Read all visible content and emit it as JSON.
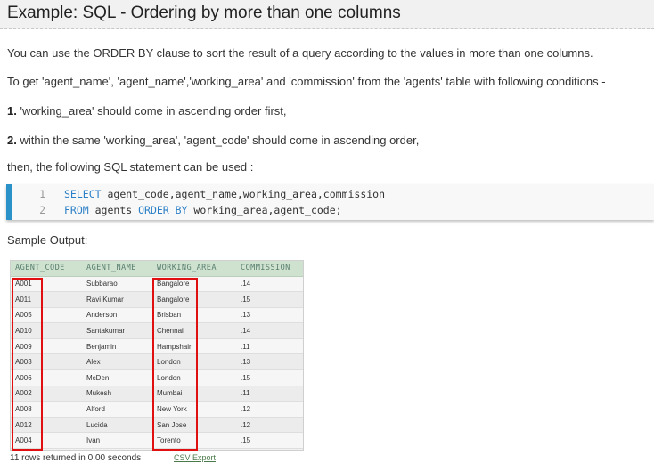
{
  "header": {
    "title": "Example: SQL - Ordering by more than one columns"
  },
  "paragraphs": {
    "p1": "You can use the ORDER BY clause to sort the result of a query according to the values in more than one columns.",
    "p2": "To get 'agent_name', 'agent_name','working_area' and 'commission' from the 'agents' table with following conditions -",
    "p3_num": "1.",
    "p3_text": " 'working_area' should come in ascending order first,",
    "p4_num": "2.",
    "p4_text": " within the same 'working_area', 'agent_code' should come in ascending order,",
    "p5": "then, the following SQL statement can be used :"
  },
  "code": {
    "line1_num": "1",
    "line1_kw": "SELECT",
    "line1_rest": " agent_code,agent_name,working_area,commission",
    "line2_num": "2",
    "line2_kw1": "FROM",
    "line2_mid": " agents ",
    "line2_kw2": "ORDER BY",
    "line2_rest": " working_area,agent_code;"
  },
  "sample_label": "Sample Output:",
  "result_table": {
    "headers": [
      "AGENT_CODE",
      "AGENT_NAME",
      "WORKING_AREA",
      "COMMISSION"
    ],
    "rows": [
      [
        "A001",
        "Subbarao",
        "Bangalore",
        ".14"
      ],
      [
        "A011",
        "Ravi Kumar",
        "Bangalore",
        ".15"
      ],
      [
        "A005",
        "Anderson",
        "Brisban",
        ".13"
      ],
      [
        "A010",
        "Santakumar",
        "Chennai",
        ".14"
      ],
      [
        "A009",
        "Benjamin",
        "Hampshair",
        ".11"
      ],
      [
        "A003",
        "Alex",
        "London",
        ".13"
      ],
      [
        "A006",
        "McDen",
        "London",
        ".15"
      ],
      [
        "A002",
        "Mukesh",
        "Mumbai",
        ".11"
      ],
      [
        "A008",
        "Alford",
        "New York",
        ".12"
      ],
      [
        "A012",
        "Lucida",
        "San Jose",
        ".12"
      ],
      [
        "A004",
        "Ivan",
        "Torento",
        ".15"
      ]
    ]
  },
  "footer": {
    "rows_returned": "11 rows returned in 0.00 seconds",
    "csv_export": "CSV Export"
  },
  "colors": {
    "accent_bar": "#2b91c9",
    "keyword": "#2b7fc6",
    "table_header_bg": "#cfe2cf",
    "highlight_box": "#e01010"
  }
}
